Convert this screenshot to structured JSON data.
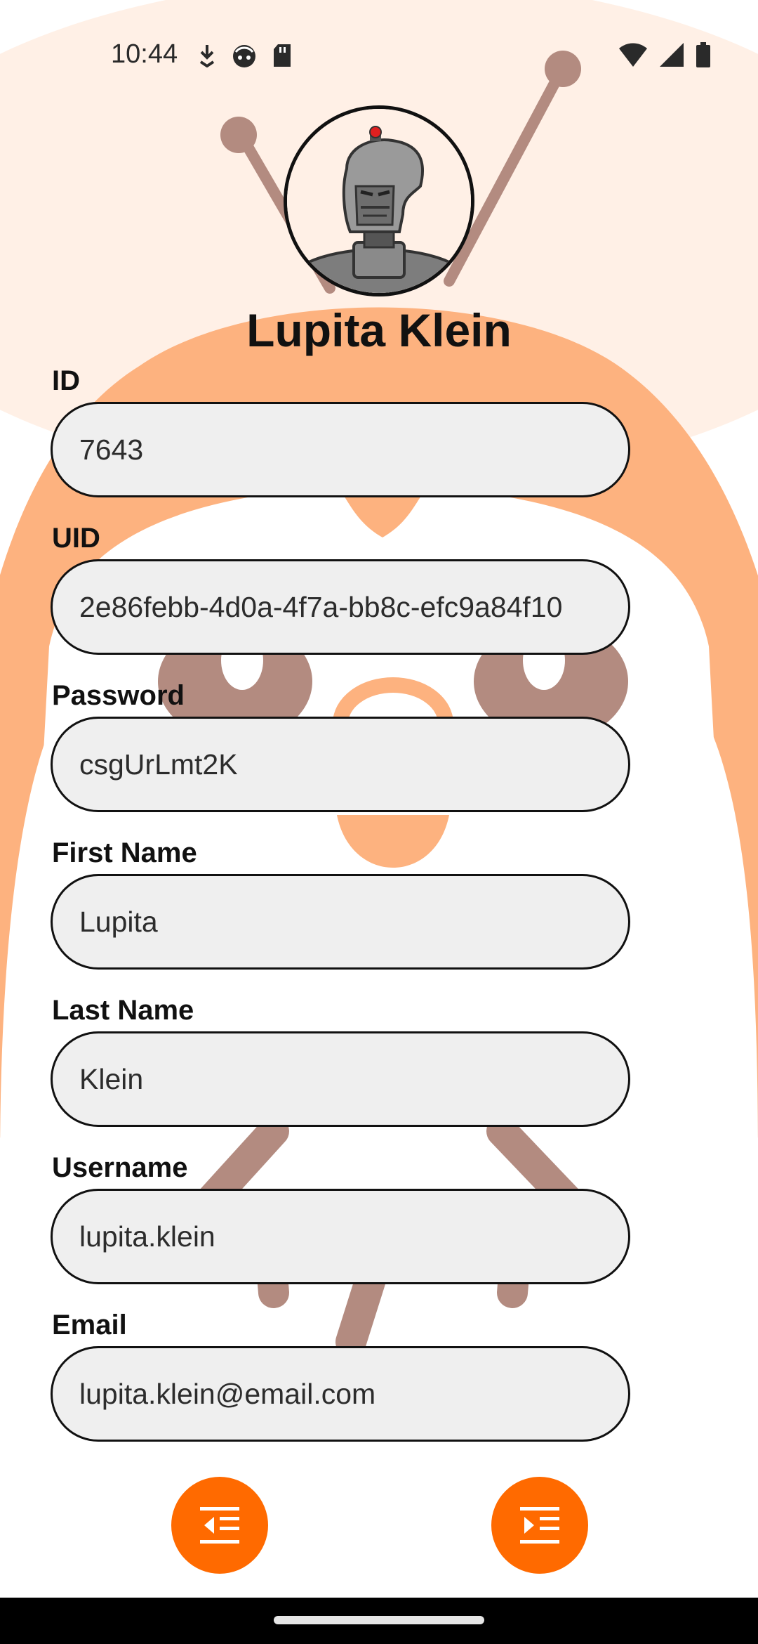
{
  "status": {
    "time": "10:44",
    "left_icons": [
      "download-icon",
      "face-icon",
      "sd-card-icon"
    ],
    "right_icons": [
      "wifi-icon",
      "signal-icon",
      "battery-icon"
    ]
  },
  "profile": {
    "display_name": "Lupita Klein",
    "avatar_icon": "robot-avatar"
  },
  "fields": {
    "id": {
      "label": "ID",
      "value": "7643"
    },
    "uid": {
      "label": "UID",
      "value": "2e86febb-4d0a-4f7a-bb8c-efc9a84f10"
    },
    "password": {
      "label": "Password",
      "value": "csgUrLmt2K"
    },
    "first_name": {
      "label": "First Name",
      "value": "Lupita"
    },
    "last_name": {
      "label": "Last Name",
      "value": "Klein"
    },
    "username": {
      "label": "Username",
      "value": "lupita.klein"
    },
    "email": {
      "label": "Email",
      "value": "lupita.klein@email.com"
    }
  },
  "actions": {
    "left_icon": "format-indent-decrease-icon",
    "right_icon": "format-indent-increase-icon"
  },
  "colors": {
    "accent": "#ff6a00",
    "background_shape": "#fdb27f",
    "background_light": "#fff0e6",
    "background_brown": "#b38b80",
    "input_fill": "#efefef"
  }
}
